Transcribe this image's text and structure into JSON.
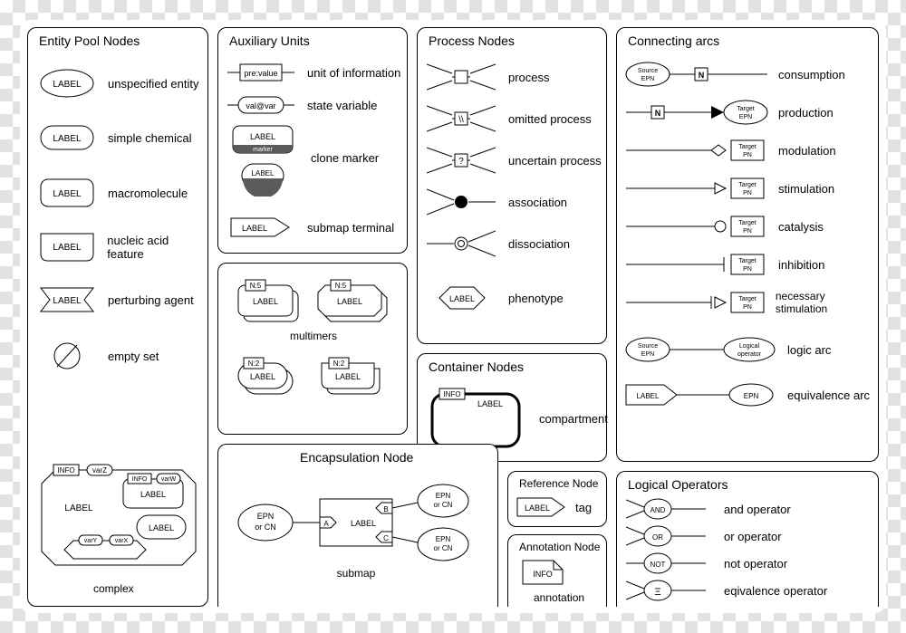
{
  "glyph_label": "LABEL",
  "entity_pool": {
    "title": "Entity Pool Nodes",
    "items": [
      {
        "label": "unspecified entity"
      },
      {
        "label": "simple chemical"
      },
      {
        "label": "macromolecule"
      },
      {
        "label": "nucleic acid feature"
      },
      {
        "label": "perturbing agent"
      },
      {
        "label": "empty set"
      }
    ],
    "complex_caption": "complex",
    "complex_info": "INFO",
    "complex_varZ": "varZ",
    "complex_varW": "varW",
    "complex_varX": "varX",
    "complex_varY": "varY"
  },
  "auxiliary": {
    "title": "Auxiliary Units",
    "items": [
      {
        "label": "unit of information",
        "inner": "pre:value"
      },
      {
        "label": "state variable",
        "inner": "val@var"
      },
      {
        "label": "clone marker",
        "marker": "marker"
      },
      {
        "label": "submap terminal"
      }
    ]
  },
  "multimers": {
    "caption": "multimers",
    "n5": "N:5",
    "n2": "N:2"
  },
  "process": {
    "title": "Process Nodes",
    "items": [
      {
        "label": "process"
      },
      {
        "label": "omitted process",
        "mark": "\\\\"
      },
      {
        "label": "uncertain process",
        "mark": "?"
      },
      {
        "label": "association"
      },
      {
        "label": "dissociation"
      },
      {
        "label": "phenotype"
      }
    ]
  },
  "container": {
    "title": "Container Nodes",
    "label": "compartment",
    "info": "INFO"
  },
  "reference": {
    "title": "Reference Node",
    "label": "tag"
  },
  "annotation": {
    "title": "Annotation Node",
    "label": "annotation",
    "info": "INFO"
  },
  "encapsulation": {
    "title": "Encapsulation Node",
    "caption": "submap",
    "epn_or_cn": "EPN\nor CN",
    "a": "A",
    "b": "B",
    "c": "C"
  },
  "arcs": {
    "title": "Connecting arcs",
    "source_epn": "Source\nEPN",
    "target_epn": "Target\nEPN",
    "target_pn": "Target\nPN",
    "logical_op": "Logical\noperator",
    "epn": "EPN",
    "n": "N",
    "items": [
      {
        "label": "consumption"
      },
      {
        "label": "production"
      },
      {
        "label": "modulation"
      },
      {
        "label": "stimulation"
      },
      {
        "label": "catalysis"
      },
      {
        "label": "inhibition"
      },
      {
        "label": "necessary stimulation"
      },
      {
        "label": "logic arc"
      },
      {
        "label": "equivalence arc"
      }
    ]
  },
  "logical": {
    "title": "Logical Operators",
    "items": [
      {
        "glyph": "AND",
        "label": "and operator"
      },
      {
        "glyph": "OR",
        "label": "or operator"
      },
      {
        "glyph": "NOT",
        "label": "not operator"
      },
      {
        "glyph": "Ξ",
        "label": "eqivalence operator"
      }
    ]
  }
}
